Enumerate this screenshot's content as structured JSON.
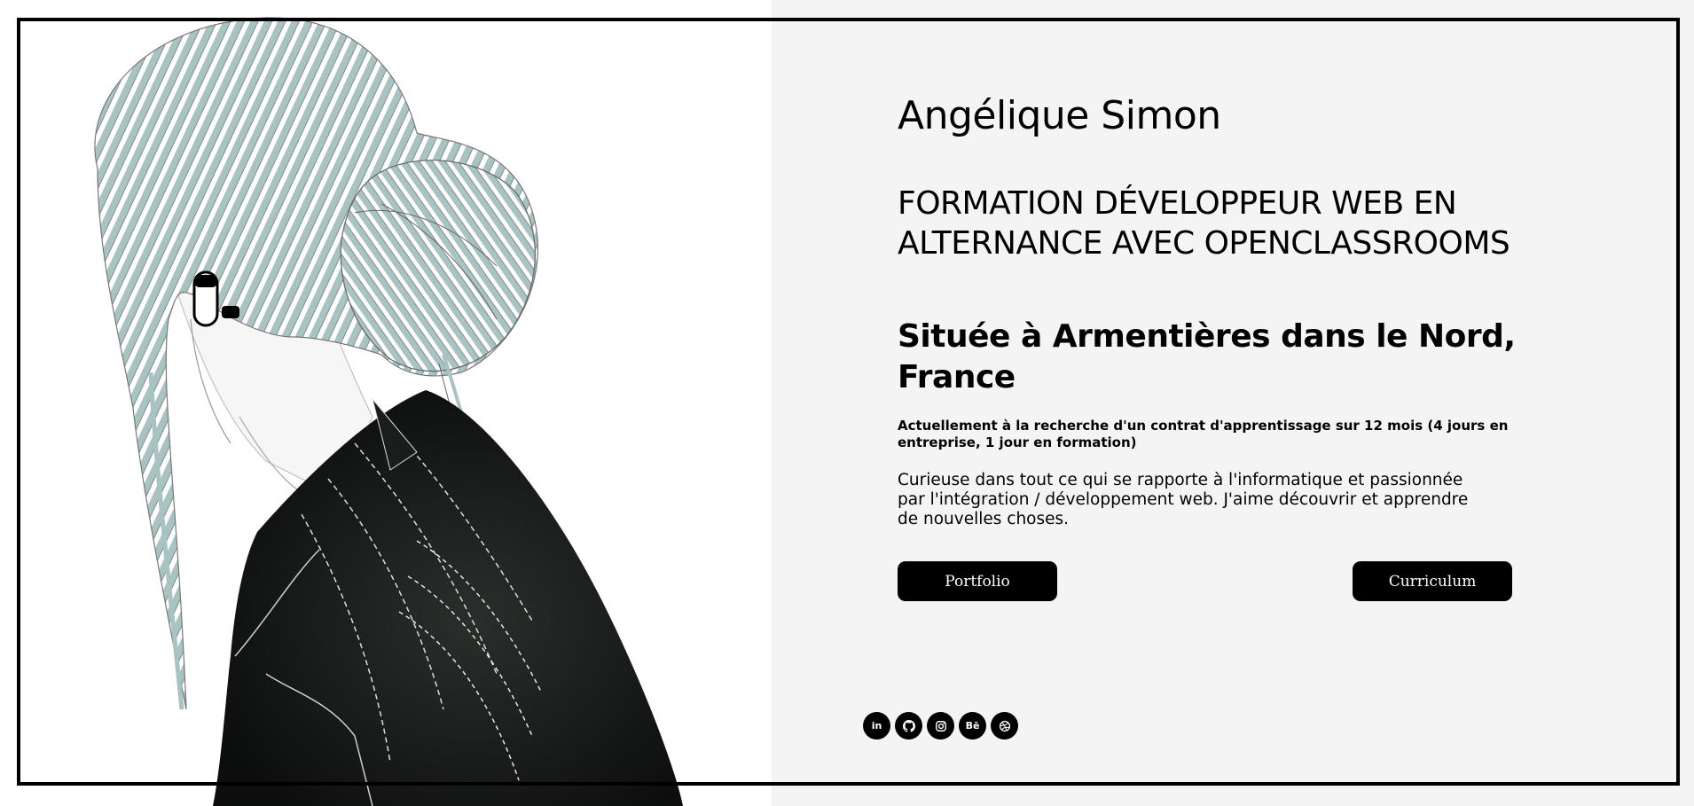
{
  "profile": {
    "name": "Angélique Simon",
    "formation": "FORMATION DÉVELOPPEUR WEB EN ALTERNANCE AVEC OPENCLASSROOMS",
    "location": "Située à Armentières dans le Nord, France",
    "search": "Actuellement à la recherche d'un contrat d'apprentissage sur 12 mois (4 jours en entreprise, 1 jour en formation)",
    "bio": "Curieuse dans tout ce qui se rapporte à l'informatique et passionnée par l'intégration / développement web. J'aime découvrir et apprendre de nouvelles choses."
  },
  "actions": {
    "portfolio_label": "Portfolio",
    "cv_label": "Curriculum"
  },
  "socials": [
    {
      "icon": "linkedin-icon",
      "label": "in"
    },
    {
      "icon": "github-icon",
      "label": ""
    },
    {
      "icon": "instagram-icon",
      "label": ""
    },
    {
      "icon": "behance-icon",
      "label": "Bē"
    },
    {
      "icon": "dribbble-icon",
      "label": ""
    }
  ],
  "colors": {
    "left_background": "#ffffff",
    "right_background": "#f4f4f4",
    "button": "#000000",
    "hair": "#a9c3c3"
  }
}
